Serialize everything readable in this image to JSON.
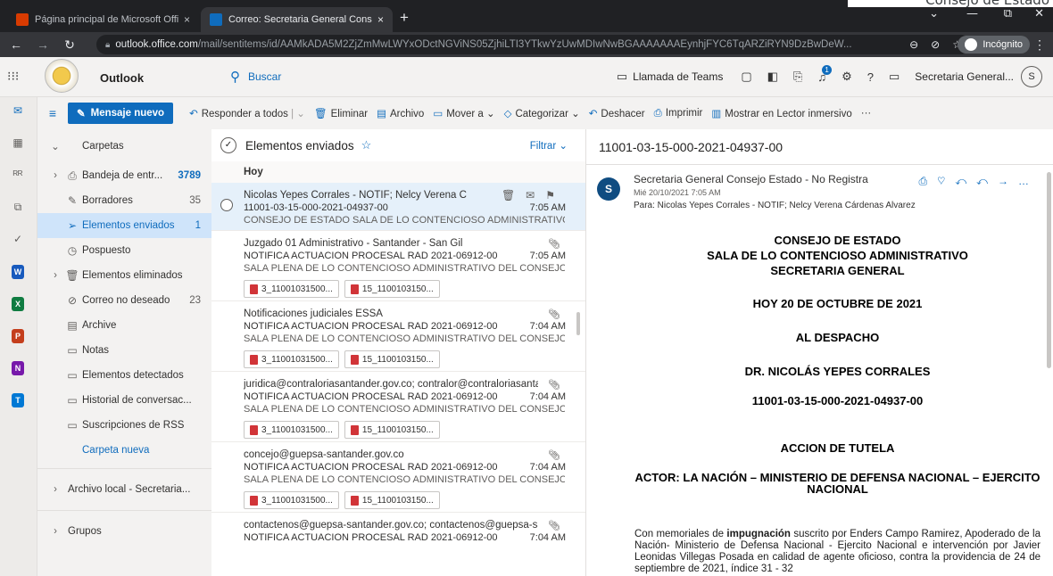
{
  "browser": {
    "corner_text": "Consejo de Estado",
    "tabs": [
      {
        "title": "Página principal de Microsoft Offi",
        "close": "×"
      },
      {
        "title": "Correo: Secretaria General Conse",
        "close": "×"
      }
    ],
    "new_tab": "+",
    "window_controls": {
      "minimize": "—",
      "maximize": "⧉",
      "close": "✕",
      "chevron": "⌄"
    },
    "url_domain": "outlook.office.com",
    "url_path": "/mail/sentitems/id/AAMkADA5M2ZjZmMwLWYxODctNGViNS05ZjhiLTI3YTkwYzUwMDIwNwBGAAAAAAAEynhjFYC6TqARZiRYN9DzBwDeW...",
    "incognito_label": "Incógnito"
  },
  "outlook_header": {
    "app_name": "Outlook",
    "search_placeholder": "Buscar",
    "teams_call": "Llamada de Teams",
    "notification_count": "1",
    "help": "?",
    "user_name": "Secretaria General...",
    "avatar_initial": "S"
  },
  "command_bar": {
    "new_message": "Mensaje nuevo",
    "reply_all": "Responder a todos",
    "delete": "Eliminar",
    "archive": "Archivo",
    "move_to": "Mover a",
    "categorize": "Categorizar",
    "undo": "Deshacer",
    "print": "Imprimir",
    "immersive": "Mostrar en Lector inmersivo",
    "more": "···"
  },
  "folders": {
    "header": "Carpetas",
    "items": [
      {
        "label": "Bandeja de entr...",
        "count": "3789"
      },
      {
        "label": "Borradores",
        "count": "35"
      },
      {
        "label": "Elementos enviados",
        "count": "1"
      },
      {
        "label": "Pospuesto",
        "count": ""
      },
      {
        "label": "Elementos eliminados",
        "count": ""
      },
      {
        "label": "Correo no deseado",
        "count": "23"
      },
      {
        "label": "Archive",
        "count": ""
      },
      {
        "label": "Notas",
        "count": ""
      },
      {
        "label": "Elementos detectados",
        "count": ""
      },
      {
        "label": "Historial de conversac...",
        "count": ""
      },
      {
        "label": "Suscripciones de RSS",
        "count": ""
      }
    ],
    "new_folder": "Carpeta nueva",
    "local_archive": "Archivo local - Secretaria...",
    "groups": "Grupos"
  },
  "message_list": {
    "folder_title": "Elementos enviados",
    "filter": "Filtrar",
    "day_group": "Hoy",
    "messages": [
      {
        "from": "Nicolas Yepes Corrales - NOTIF; Nelcy Verena Cárdenas ...",
        "subject": "11001-03-15-000-2021-04937-00",
        "time": "7:05 AM",
        "preview": "CONSEJO DE ESTADO SALA DE LO CONTENCIOSO ADMINISTRATIVO SE..."
      },
      {
        "from": "Juzgado 01 Administrativo - Santander - San Gil",
        "subject": "NOTIFICA ACTUACION PROCESAL RAD 2021-06912-00",
        "time": "7:05 AM",
        "preview": "SALA PLENA DE LO CONTENCIOSO ADMINISTRATIVO DEL CONSEJO DE ...",
        "att1": "3_11001031500...",
        "att2": "15_1100103150..."
      },
      {
        "from": "Notificaciones judiciales ESSA",
        "subject": "NOTIFICA ACTUACION PROCESAL RAD 2021-06912-00",
        "time": "7:04 AM",
        "preview": "SALA PLENA DE LO CONTENCIOSO ADMINISTRATIVO DEL CONSEJO DE ...",
        "att1": "3_11001031500...",
        "att2": "15_1100103150..."
      },
      {
        "from": "juridica@contraloriasantander.gov.co; contralor@contraloriasanta...",
        "subject": "NOTIFICA ACTUACION PROCESAL RAD 2021-06912-00",
        "time": "7:04 AM",
        "preview": "SALA PLENA DE LO CONTENCIOSO ADMINISTRATIVO DEL CONSEJO DE ...",
        "att1": "3_11001031500...",
        "att2": "15_1100103150..."
      },
      {
        "from": "concejo@guepsa-santander.gov.co",
        "subject": "NOTIFICA ACTUACION PROCESAL RAD 2021-06912-00",
        "time": "7:04 AM",
        "preview": "SALA PLENA DE LO CONTENCIOSO ADMINISTRATIVO DEL CONSEJO DE ...",
        "att1": "3_11001031500...",
        "att2": "15_1100103150..."
      },
      {
        "from": "contactenos@guepsa-santander.gov.co; contactenos@guepsa-sa...",
        "subject": "NOTIFICA ACTUACION PROCESAL RAD 2021-06912-00",
        "time": "7:04 AM"
      }
    ]
  },
  "reading_pane": {
    "subject": "11001-03-15-000-2021-04937-00",
    "sender": "Secretaria General Consejo Estado - No Registra",
    "date": "Mié 20/10/2021 7:05 AM",
    "to": "Para:  Nicolas Yepes Corrales - NOTIF; Nelcy Verena Cárdenas Alvarez",
    "avatar_initial": "S",
    "body": {
      "line1": "CONSEJO DE ESTADO",
      "line2": "SALA DE LO CONTENCIOSO ADMINISTRATIVO",
      "line3": "SECRETARIA GENERAL",
      "date_line": "HOY 20 DE OCTUBRE DE 2021",
      "despacho": "AL DESPACHO",
      "magistrate": "DR. NICOLÁS YEPES CORRALES",
      "radicado": "11001-03-15-000-2021-04937-00",
      "action": "ACCION DE TUTELA",
      "actor": "ACTOR: LA NACIÓN – MINISTERIO DE DEFENSA NACIONAL – EJERCITO NACIONAL",
      "para_pre": "Con memoriales de",
      "para_bold": "impugnación",
      "para_post": "suscrito por Enders Campo Ramirez, Apoderado de la Nación- Ministerio de Defensa Nacional - Ejercito Nacional e intervención por Javier Leonidas Villegas Posada en calidad de agente oficioso, contra la providencia de 24 de septiembre de 2021, índice 31 - 32"
    }
  },
  "colors": {
    "accent": "#0f6cbd",
    "chrome_dark": "#202124",
    "selected_folder": "#cfe4fa"
  }
}
